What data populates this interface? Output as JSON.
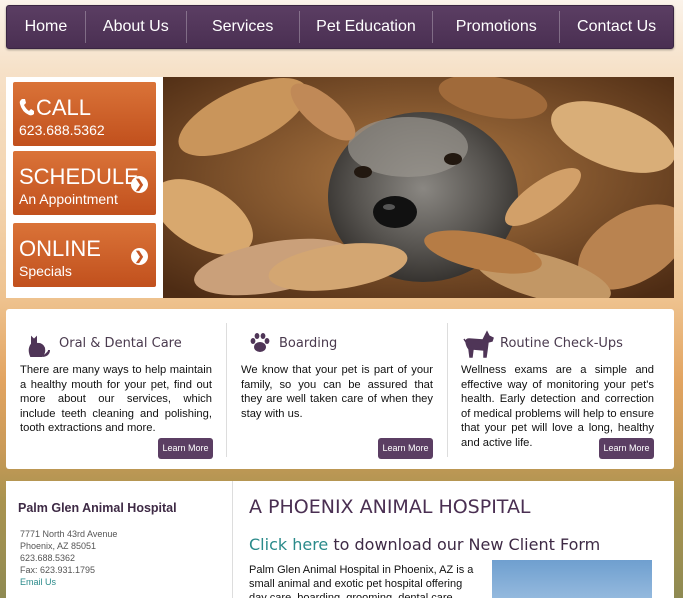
{
  "nav": [
    "Home",
    "About Us",
    "Services",
    "Pet Education",
    "Promotions",
    "Contact Us"
  ],
  "cta": {
    "call": {
      "title": "CALL",
      "sub": "623.688.5362"
    },
    "schedule": {
      "title": "SCHEDULE",
      "sub": "An Appointment"
    },
    "online": {
      "title": "ONLINE",
      "sub": "Specials"
    }
  },
  "services": [
    {
      "title": "Oral & Dental Care",
      "icon": "cat-icon",
      "text": "There are many ways to help maintain a healthy mouth for your pet, find out more about our services, which include teeth cleaning and polishing, tooth extractions and more.",
      "button": "Learn More"
    },
    {
      "title": "Boarding",
      "icon": "paw-icon",
      "text": "We know that your pet is part of your family, so you can be assured that they are well taken care of when they stay with us.",
      "button": "Learn More"
    },
    {
      "title": "Routine Check-Ups",
      "icon": "dog-icon",
      "text": "Wellness exams are a simple and effective way of monitoring your pet's health. Early detection and correction of medical problems will help to ensure that your pet will love a long, healthy and active life.",
      "button": "Learn More"
    }
  ],
  "contact": {
    "name": "Palm Glen Animal Hospital",
    "address1": "7771 North 43rd Avenue",
    "address2": "Phoenix, AZ 85051",
    "phone": "623.688.5362",
    "fax": "Fax: 623.931.1795",
    "email": "Email Us"
  },
  "main": {
    "heading": "A PHOENIX ANIMAL HOSPITAL",
    "link": "Click here",
    "link_rest": " to download our New Client Form",
    "body": "Palm Glen Animal Hospital in Phoenix, AZ is a small animal and exotic pet hospital offering day care, boarding, grooming, dental care, vaccinations, et"
  },
  "colors": {
    "brand_purple": "#4f3557",
    "cta_orange": "#c9571f",
    "link_teal": "#2a8a8a"
  }
}
